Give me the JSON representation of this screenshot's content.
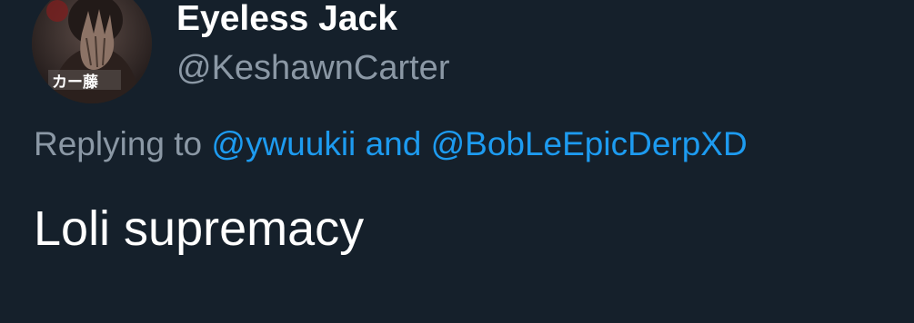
{
  "colors": {
    "background": "#15202b",
    "primary_text": "#ffffff",
    "secondary_text": "#8b98a5",
    "link": "#1d9bf0"
  },
  "author": {
    "display_name": "Eyeless Jack",
    "handle": "@KeshawnCarter",
    "avatar_icon": "profile-avatar",
    "avatar_caption": "カー藤"
  },
  "reply": {
    "prefix": "Replying to",
    "mention_1": "@ywuukii",
    "conjunction": "and",
    "mention_2": "@BobLeEpicDerpXD"
  },
  "tweet": {
    "text": "Loli supremacy"
  }
}
